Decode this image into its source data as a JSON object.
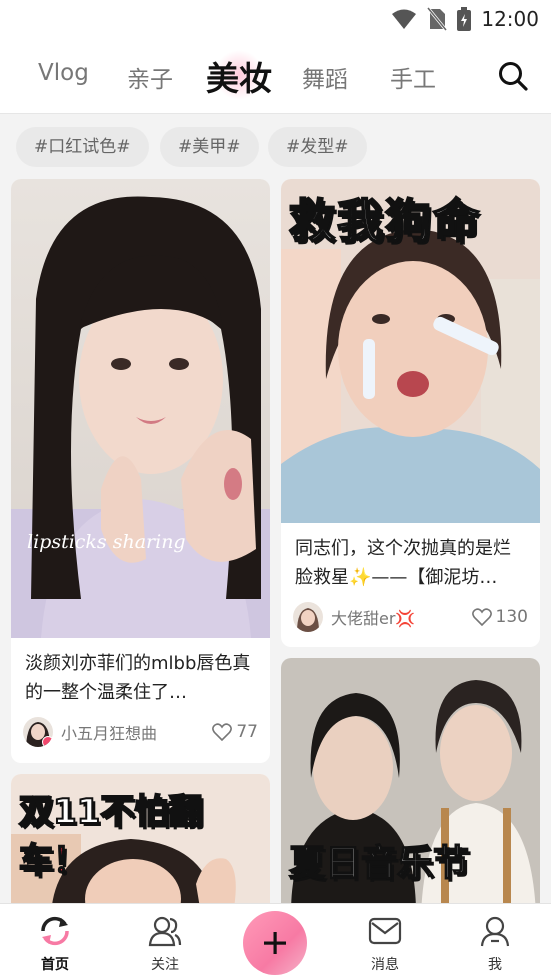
{
  "status_bar": {
    "time": "12:00",
    "icons": [
      "wifi-icon",
      "no-sim-icon",
      "battery-icon"
    ]
  },
  "top_nav": {
    "tabs": [
      {
        "label": "Vlog"
      },
      {
        "label": "亲子"
      },
      {
        "label": "美妆",
        "active": true
      },
      {
        "label": "舞蹈"
      },
      {
        "label": "手工"
      }
    ],
    "search_icon": "search-icon"
  },
  "chips": [
    "#口红试色#",
    "#美甲#",
    "#发型#"
  ],
  "cards": [
    {
      "overlay": "lipsticks sharing",
      "title": "淡颜刘亦菲们的mlbb唇色真的一整个温柔住了…",
      "author": "小五月狂想曲",
      "likes": "77"
    },
    {
      "banner": "救我狗命",
      "title": "同志们，这个次抛真的是烂脸救星✨——【御泥坊…",
      "author": "大佬甜er💢",
      "likes": "130"
    },
    {
      "banner": "双11不怕翻车！",
      "banner_a": "双11",
      "banner_b": "不怕翻车！"
    },
    {
      "banner": "夏日音乐节"
    }
  ],
  "bottom_nav": {
    "items": [
      {
        "label": "首页",
        "icon": "home-refresh-icon",
        "active": true
      },
      {
        "label": "关注",
        "icon": "follow-users-icon"
      },
      {
        "label": "",
        "icon": "plus-icon"
      },
      {
        "label": "消息",
        "icon": "mail-icon"
      },
      {
        "label": "我",
        "icon": "profile-icon"
      }
    ]
  },
  "colors": {
    "accent": "#f77aa4",
    "active_text": "#111111",
    "muted": "#777777"
  }
}
